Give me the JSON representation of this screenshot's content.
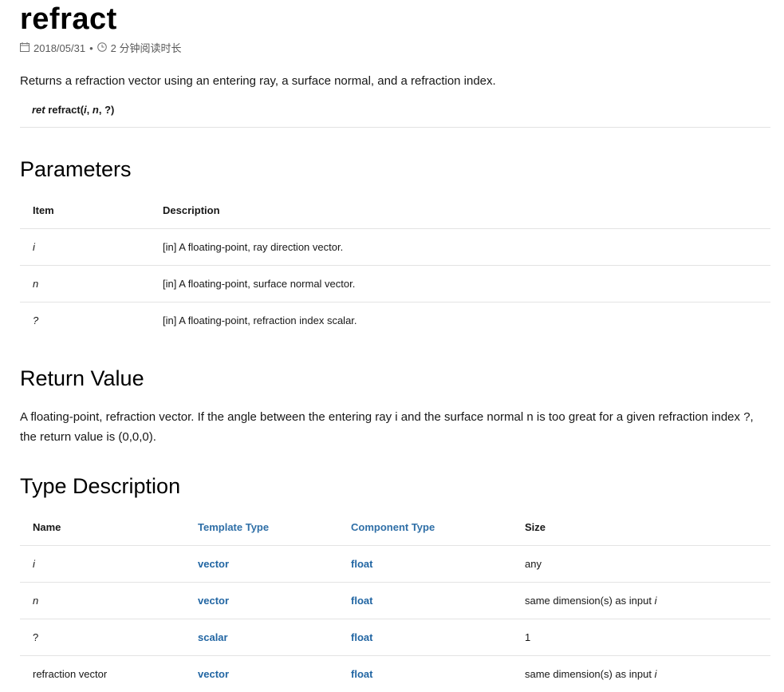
{
  "title": "refract",
  "meta": {
    "date": "2018/05/31",
    "read_time": "2 分钟阅读时长"
  },
  "intro": "Returns a refraction vector using an entering ray, a surface normal, and a refraction index.",
  "syntax": {
    "ret": "ret",
    "fn": " refract(",
    "a1": "i",
    "s1": ", ",
    "a2": "n",
    "s2": ", ?)"
  },
  "parameters": {
    "heading": "Parameters",
    "headers": [
      "Item",
      "Description"
    ],
    "rows": [
      {
        "item": "i",
        "desc": "[in] A floating-point, ray direction vector."
      },
      {
        "item": "n",
        "desc": "[in] A floating-point, surface normal vector."
      },
      {
        "item": "?",
        "desc": "[in] A floating-point, refraction index scalar."
      }
    ]
  },
  "return_value": {
    "heading": "Return Value",
    "text": "A floating-point, refraction vector. If the angle between the entering ray i and the surface normal n is too great for a given refraction index ?, the return value is (0,0,0)."
  },
  "type_description": {
    "heading": "Type Description",
    "headers": [
      "Name",
      "Template Type",
      "Component Type",
      "Size"
    ],
    "rows": [
      {
        "name": "i",
        "template": "vector",
        "component": "float",
        "size": "any",
        "size_i": ""
      },
      {
        "name": "n",
        "template": "vector",
        "component": "float",
        "size": "same dimension(s) as input ",
        "size_i": "i"
      },
      {
        "name": "?",
        "template": "scalar",
        "component": "float",
        "size": "1",
        "size_i": ""
      },
      {
        "name": "refraction vector",
        "template": "vector",
        "component": "float",
        "size": "same dimension(s) as input ",
        "size_i": "i"
      }
    ]
  },
  "colors": {
    "link": "#2266a3",
    "rule": "#e3e3e3",
    "meta": "#5a5a5a"
  },
  "icons": {
    "date": "calendar-icon",
    "time": "clock-icon"
  }
}
